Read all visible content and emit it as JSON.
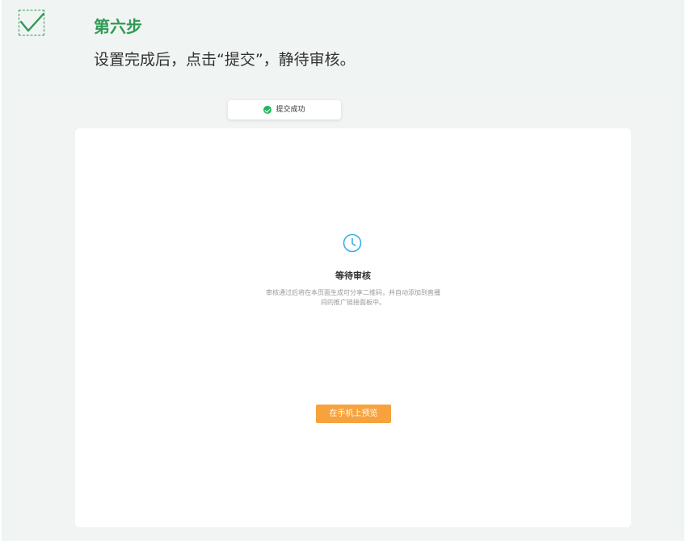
{
  "step": {
    "icon": "checkmark-icon",
    "title": "第六步",
    "description": "设置完成后，点击“提交”，静待审核。"
  },
  "toast": {
    "icon": "success-check-icon",
    "text": "提交成功"
  },
  "status": {
    "icon": "clock-icon",
    "title": "等待审核",
    "description_line1": "审核通过后将在本页面生成可分享二维码，并自动添加到直播",
    "description_line2": "间的推广链接面板中。"
  },
  "preview_button": {
    "label": "在手机上预览"
  },
  "colors": {
    "accent_green": "#2f9a55",
    "toast_green": "#1fb65a",
    "clock_blue": "#3aaeea",
    "button_orange": "#f7a23c"
  }
}
